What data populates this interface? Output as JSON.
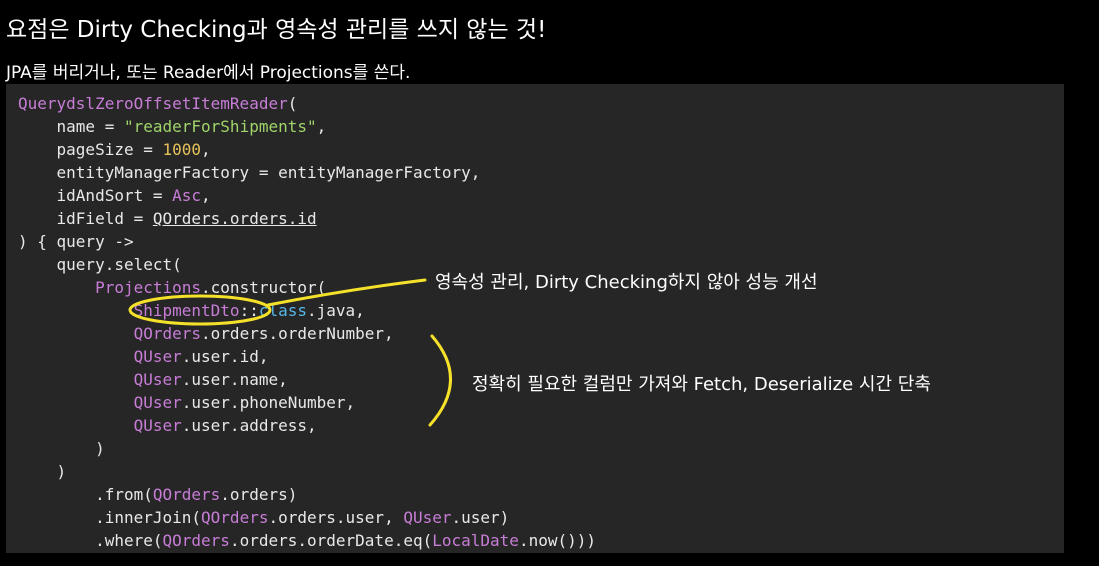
{
  "heading": "요점은 Dirty Checking과 영속성 관리를 쓰지 않는 것!",
  "subheading": "JPA를 버리거나, 또는 Reader에서 Projections를 쓴다.",
  "code": {
    "l1": {
      "a": "QuerydslZeroOffsetItemReader",
      "b": "("
    },
    "l2": {
      "a": "    name = ",
      "b": "\"readerForShipments\"",
      "c": ","
    },
    "l3": {
      "a": "    pageSize = ",
      "b": "1000",
      "c": ","
    },
    "l4": {
      "a": "    entityManagerFactory = entityManagerFactory,"
    },
    "l5": {
      "a": "    idAndSort = ",
      "b": "Asc",
      "c": ","
    },
    "l6": {
      "a": "    idField = ",
      "b": "QOrders.orders.id"
    },
    "l7": {
      "a": ") { query ->"
    },
    "l8": {
      "a": "    query.select("
    },
    "l9": {
      "a": "        ",
      "b": "Projections",
      "c": ".constructor("
    },
    "l10": {
      "a": "            ",
      "b": "ShipmentDto",
      "c": "::",
      "d": "class",
      "e": ".java,"
    },
    "l11": {
      "a": "            ",
      "b": "QOrders",
      "c": ".orders.orderNumber,"
    },
    "l12": {
      "a": "            ",
      "b": "QUser",
      "c": ".user.id,"
    },
    "l13": {
      "a": "            ",
      "b": "QUser",
      "c": ".user.name,"
    },
    "l14": {
      "a": "            ",
      "b": "QUser",
      "c": ".user.phoneNumber,"
    },
    "l15": {
      "a": "            ",
      "b": "QUser",
      "c": ".user.address,"
    },
    "l16": {
      "a": "        )"
    },
    "l17": {
      "a": "    )"
    },
    "l18": {
      "a": "        .from(",
      "b": "QOrders",
      "c": ".orders)"
    },
    "l19": {
      "a": "        .innerJoin(",
      "b": "QOrders",
      "c": ".orders.user, ",
      "d": "QUser",
      "e": ".user)"
    },
    "l20": {
      "a": "        .where(",
      "b": "QOrders",
      "c": ".orders.orderDate.eq(",
      "d": "LocalDate",
      "e": ".now()))"
    }
  },
  "annotations": {
    "first": "영속성 관리, Dirty Checking하지 않아 성능 개선",
    "second": "정확히 필요한 컬럼만 가져와 Fetch, Deserialize 시간 단축"
  },
  "colors": {
    "highlight": "#f5e12a",
    "class": "#c77dd6",
    "string": "#9fd46a",
    "number": "#e5c25a",
    "keyword": "#55b8e8"
  }
}
